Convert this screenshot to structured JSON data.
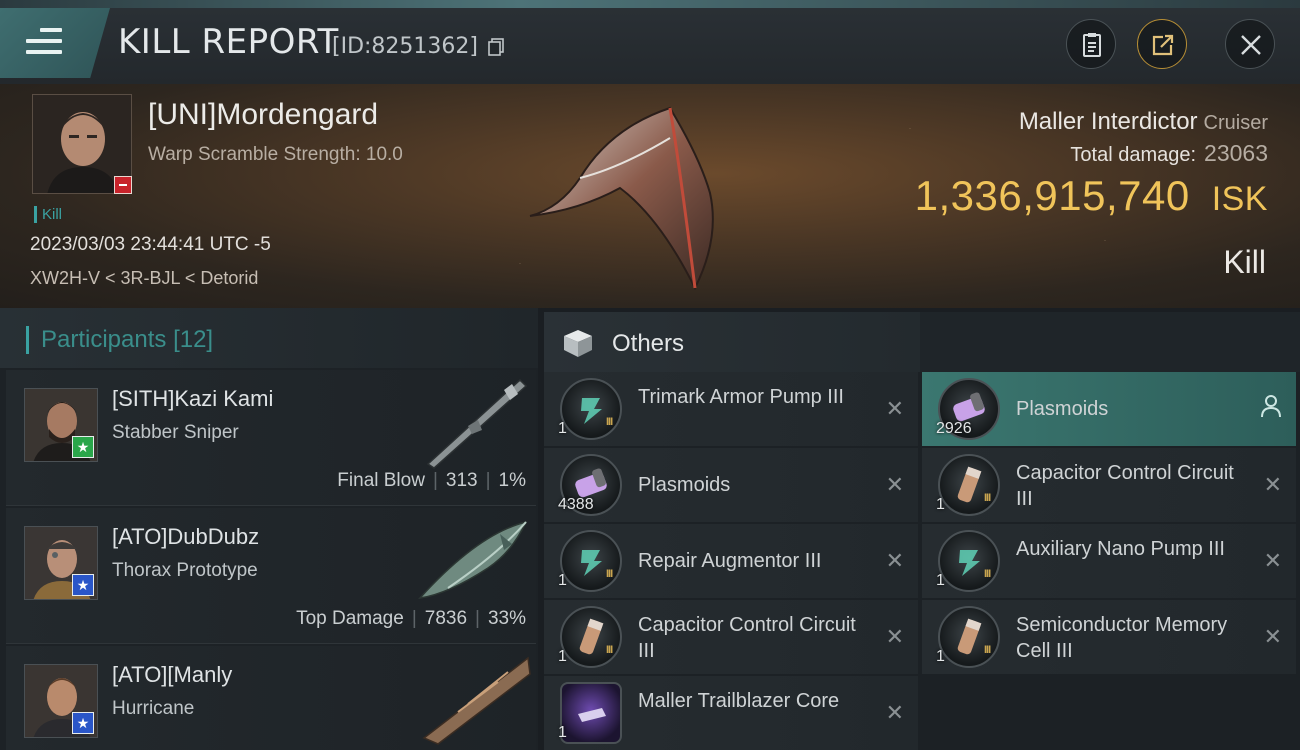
{
  "header": {
    "title": "KILL REPORT",
    "id_text": "[ID:8251362]"
  },
  "victim": {
    "name": "[UNI]Mordengard",
    "detail": "Warp Scramble Strength: 10.0",
    "tag": "Kill",
    "time": "2023/03/03 23:44:41 UTC -5",
    "location": "XW2H-V < 3R-BJL < Detorid",
    "ship_name": "Maller Interdictor",
    "ship_class": "Cruiser",
    "total_damage_label": "Total damage:",
    "total_damage_value": "23063",
    "isk_value": "1,336,915,740",
    "isk_unit": "ISK",
    "result": "Kill"
  },
  "participants": {
    "title": "Participants",
    "count": "[12]",
    "rows": [
      {
        "name": "[SITH]Kazi Kami",
        "ship": "Stabber Sniper",
        "role": "Final Blow",
        "damage": "313",
        "percent": "1%",
        "badge": "green"
      },
      {
        "name": "[ATO]DubDubz",
        "ship": "Thorax Prototype",
        "role": "Top Damage",
        "damage": "7836",
        "percent": "33%",
        "badge": "blue"
      },
      {
        "name": "[ATO][Manly",
        "ship": "Hurricane",
        "badge": "blue"
      }
    ]
  },
  "others": {
    "title": "Others",
    "left": [
      {
        "name": "Trimark Armor Pump III",
        "qty": "1",
        "icon": "rig-icon",
        "tier": "III"
      },
      {
        "name": "Plasmoids",
        "qty": "4388",
        "icon": "plasmoid-icon"
      },
      {
        "name": "Repair Augmentor III",
        "qty": "1",
        "icon": "rig-icon",
        "tier": "III"
      },
      {
        "name": "Capacitor Control Circuit III",
        "qty": "1",
        "icon": "capacitor-icon",
        "tier": "III"
      },
      {
        "name": "Maller Trailblazer Core",
        "qty": "1",
        "icon": "core-icon"
      }
    ],
    "right": [
      {
        "name": "Plasmoids",
        "qty": "2926",
        "icon": "plasmoid-icon",
        "highlight": true
      },
      {
        "name": "Capacitor Control Circuit III",
        "qty": "1",
        "icon": "capacitor-icon",
        "tier": "III"
      },
      {
        "name": "Auxiliary Nano Pump III",
        "qty": "1",
        "icon": "rig-icon",
        "tier": "III"
      },
      {
        "name": "Semiconductor Memory Cell III",
        "qty": "1",
        "icon": "capacitor-icon",
        "tier": "III"
      }
    ]
  },
  "colors": {
    "accent_teal": "#3aa2a2",
    "isk_gold": "#f0c45a",
    "highlight_row": "#3b7770"
  }
}
